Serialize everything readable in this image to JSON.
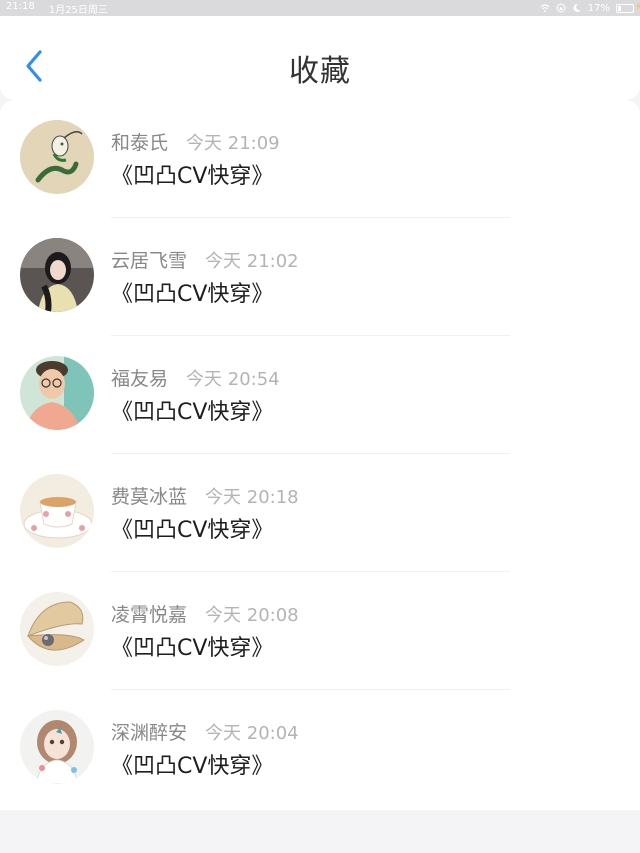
{
  "status_bar": {
    "time": "21:18",
    "date": "1月25日周三",
    "battery": "17%"
  },
  "header": {
    "title": "收藏",
    "back_icon": "chevron-left-icon"
  },
  "colors": {
    "accent": "#2e8ff0",
    "author_text": "#888888",
    "time_text": "#b4b4b4"
  },
  "favorites": [
    {
      "author": "和泰氏",
      "time": "今天 21:09",
      "title": "《凹凸CV快穿》"
    },
    {
      "author": "云居飞雪",
      "time": "今天 21:02",
      "title": "《凹凸CV快穿》"
    },
    {
      "author": "福友易",
      "time": "今天 20:54",
      "title": "《凹凸CV快穿》"
    },
    {
      "author": "费莫冰蓝",
      "time": "今天 20:18",
      "title": "《凹凸CV快穿》"
    },
    {
      "author": "凌霄悦嘉",
      "time": "今天 20:08",
      "title": "《凹凸CV快穿》"
    },
    {
      "author": "深渊醉安",
      "time": "今天 20:04",
      "title": "《凹凸CV快穿》"
    }
  ]
}
